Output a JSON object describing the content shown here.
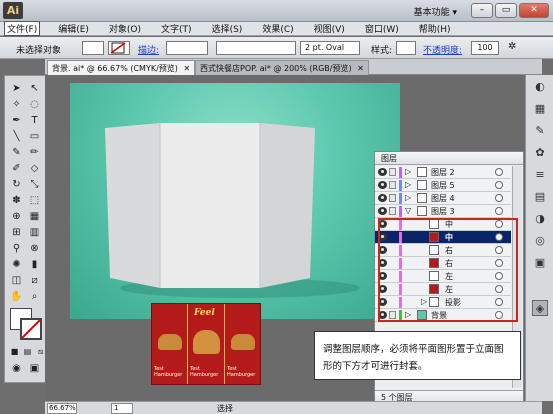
{
  "app": {
    "logo": "Ai",
    "workspace": "基本功能 ▾",
    "win_min": "–",
    "win_max": "▭",
    "win_close": "✕"
  },
  "menu": [
    "文件(F)",
    "编辑(E)",
    "对象(O)",
    "文字(T)",
    "选择(S)",
    "效果(C)",
    "视图(V)",
    "窗口(W)",
    "帮助(H)"
  ],
  "control": {
    "selection": "未选择对象",
    "stroke_label": "描边:",
    "stroke_weight": "",
    "brush": "2 pt. Oval",
    "style_label": "样式:",
    "opacity_label": "不透明度:",
    "opacity_value": "100"
  },
  "tabs": [
    {
      "label": "背景. ai* @ 66.67% (CMYK/预览)",
      "close": "✕"
    },
    {
      "label": "西式快餐店POP. ai* @ 200% (RGB/预览)",
      "close": "✕"
    }
  ],
  "layers": {
    "title": "图层",
    "rows": [
      {
        "name": "图层 2",
        "color": "#b066ff"
      },
      {
        "name": "图层 5",
        "color": "#6a8cff"
      },
      {
        "name": "图层 4",
        "color": "#6a8cff"
      },
      {
        "name": "图层 3",
        "color": "#b066ff"
      },
      {
        "name": "中",
        "color": "#e070e0"
      },
      {
        "name": "中",
        "color": "#e070e0",
        "selected": true
      },
      {
        "name": "右",
        "color": "#e070e0"
      },
      {
        "name": "右",
        "color": "#e070e0"
      },
      {
        "name": "左",
        "color": "#e070e0"
      },
      {
        "name": "左",
        "color": "#e070e0"
      },
      {
        "name": "投影",
        "color": "#e070e0"
      },
      {
        "name": "背景",
        "color": "#40c040"
      }
    ],
    "footer": "5 个图层"
  },
  "callout": "调整图层顺序，必须将平面图形置于立面图形的下方才可进行封套。",
  "status": {
    "zoom": "66.67%",
    "page": "1",
    "mode": "选择"
  },
  "poster": {
    "brand": "Feel",
    "text1": "Test Hamburger",
    "text2": "Test Hamburger",
    "text3": "Test Hamburger"
  },
  "colors": {
    "artboard": "#5cc8ae",
    "poster": "#b31b1b",
    "highlight": "#c62a1c",
    "selected_layer": "#0a246a"
  }
}
